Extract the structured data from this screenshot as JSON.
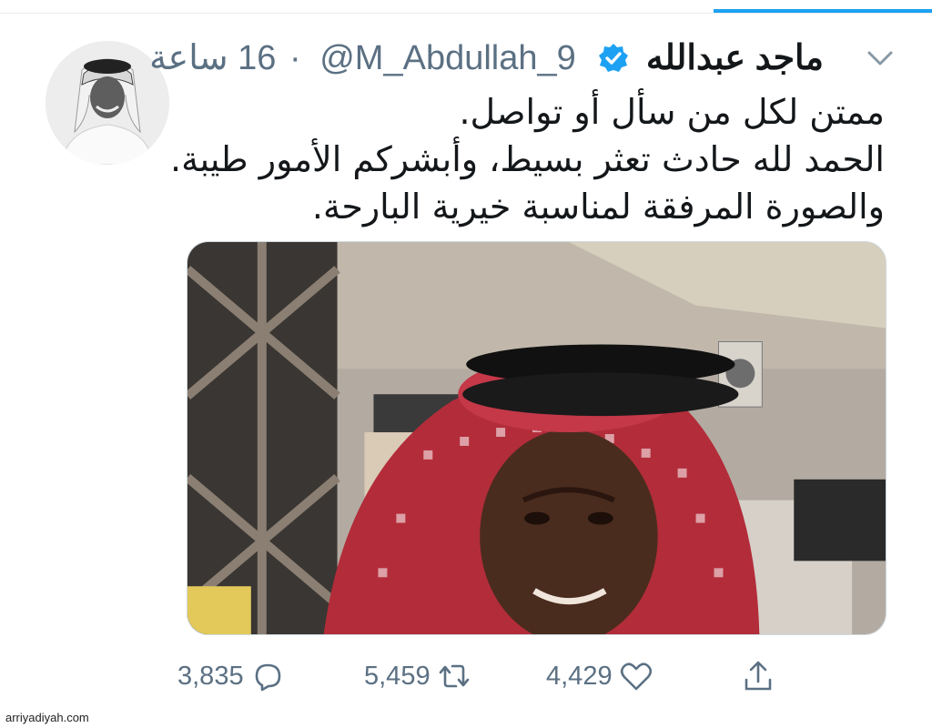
{
  "tweet": {
    "display_name": "ماجد عبدالله",
    "handle": "@M_Abdullah_9",
    "separator": "·",
    "time_ago": "16 ساعة",
    "text_lines": [
      "ممتن لكل من سأل أو تواصل.",
      "الحمد لله حادث تعثر بسيط، وأبشركم الأمور طيبة.",
      "والصورة المرفقة لمناسبة خيرية البارحة."
    ],
    "verified": true
  },
  "actions": {
    "reply_count": "3,835",
    "retweet_count": "5,459",
    "like_count": "4,429"
  },
  "icons": {
    "caret": "chevron-down-icon",
    "verified": "verified-badge-icon",
    "reply": "reply-icon",
    "retweet": "retweet-icon",
    "like": "heart-icon",
    "share": "share-icon"
  },
  "colors": {
    "accent": "#1da1f2",
    "muted": "#5b7083",
    "text": "#14171a"
  },
  "watermark": "arriyadiyah.com"
}
